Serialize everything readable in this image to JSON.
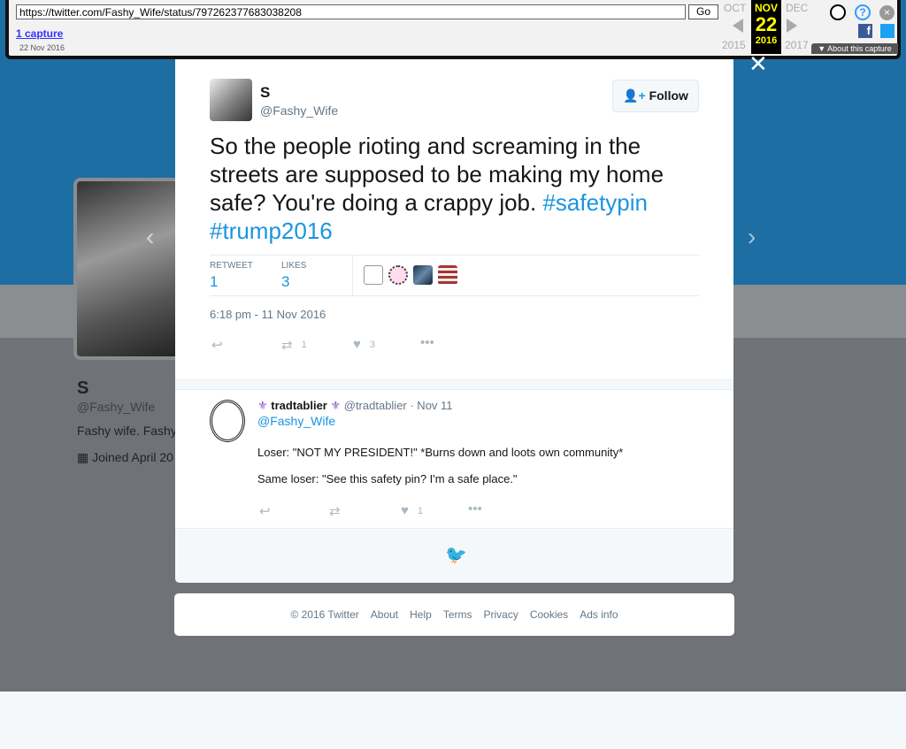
{
  "wayback": {
    "url": "https://twitter.com/Fashy_Wife/status/797262377683038208",
    "go": "Go",
    "captures": "1 capture",
    "capture_date": "22 Nov 2016",
    "prev_month": "OCT",
    "cur_month": "NOV",
    "next_month": "DEC",
    "cur_day": "22",
    "prev_year": "2015",
    "cur_year": "2016",
    "next_year": "2017",
    "about": "▼ About this capture"
  },
  "profile": {
    "name": "S",
    "handle": "@Fashy_Wife",
    "bio": "Fashy wife. Fashy",
    "joined": "Joined April 20"
  },
  "tweet": {
    "name": "S",
    "handle": "@Fashy_Wife",
    "follow": "Follow",
    "text": "So the people rioting and screaming in the streets are supposed to be making my home safe? You're doing a crappy job. ",
    "tags": [
      "#safetypin",
      "#trump2016"
    ],
    "retweet_label": "RETWEET",
    "retweets": "1",
    "likes_label": "LIKES",
    "likes": "3",
    "time": "6:18 pm - 11 Nov 2016",
    "rt_count": "1",
    "like_count": "3"
  },
  "reply": {
    "name": "tradtablier",
    "handle": "@tradtablier · Nov 11",
    "mention": "@Fashy_Wife",
    "line1": "Loser: \"NOT MY PRESIDENT!\" *Burns down and loots own community*",
    "line2": "Same loser: \"See this safety pin? I'm a safe place.\"",
    "like_count": "1"
  },
  "footer": [
    "© 2016 Twitter",
    "About",
    "Help",
    "Terms",
    "Privacy",
    "Cookies",
    "Ads info"
  ],
  "colors": {
    "link": "#1b95e0",
    "header": "#1d6ea3"
  }
}
